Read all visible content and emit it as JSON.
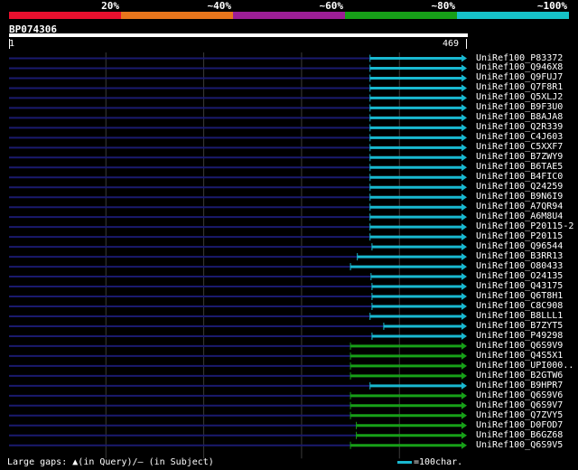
{
  "legend": {
    "segments": [
      {
        "label": "20%",
        "color": "#e8102e"
      },
      {
        "label": "~40%",
        "color": "#e8761c"
      },
      {
        "label": "~60%",
        "color": "#9c1e96"
      },
      {
        "label": "~80%",
        "color": "#17a018"
      },
      {
        "label": "~100%",
        "color": "#16c2c8"
      }
    ]
  },
  "query": {
    "name": "BP074306",
    "start": "1",
    "end": "469"
  },
  "colors": {
    "cyan": "#19b8d0",
    "green": "#17a018",
    "navy": "#1a1a6e",
    "grid": "#3a3a3a"
  },
  "hits": [
    {
      "name": "UniRef100_P83372",
      "start": 370,
      "end": 469,
      "color": "cyan"
    },
    {
      "name": "UniRef100_Q946X8",
      "start": 370,
      "end": 469,
      "color": "cyan"
    },
    {
      "name": "UniRef100_Q9FUJ7",
      "start": 370,
      "end": 469,
      "color": "cyan"
    },
    {
      "name": "UniRef100_Q7F8R1",
      "start": 370,
      "end": 469,
      "color": "cyan"
    },
    {
      "name": "UniRef100_Q5XLJ2",
      "start": 370,
      "end": 469,
      "color": "cyan"
    },
    {
      "name": "UniRef100_B9F3U0",
      "start": 370,
      "end": 469,
      "color": "cyan"
    },
    {
      "name": "UniRef100_B8AJA8",
      "start": 370,
      "end": 469,
      "color": "cyan"
    },
    {
      "name": "UniRef100_Q2R339",
      "start": 370,
      "end": 469,
      "color": "cyan"
    },
    {
      "name": "UniRef100_C4J603",
      "start": 370,
      "end": 469,
      "color": "cyan"
    },
    {
      "name": "UniRef100_C5XXF7",
      "start": 370,
      "end": 469,
      "color": "cyan"
    },
    {
      "name": "UniRef100_B7ZWY9",
      "start": 370,
      "end": 469,
      "color": "cyan"
    },
    {
      "name": "UniRef100_B6TAE5",
      "start": 370,
      "end": 469,
      "color": "cyan"
    },
    {
      "name": "UniRef100_B4FIC0",
      "start": 370,
      "end": 469,
      "color": "cyan"
    },
    {
      "name": "UniRef100_Q24259",
      "start": 370,
      "end": 469,
      "color": "cyan"
    },
    {
      "name": "UniRef100_B9N6I9",
      "start": 370,
      "end": 469,
      "color": "cyan"
    },
    {
      "name": "UniRef100_A7QR94",
      "start": 370,
      "end": 469,
      "color": "cyan"
    },
    {
      "name": "UniRef100_A6M8U4",
      "start": 370,
      "end": 469,
      "color": "cyan"
    },
    {
      "name": "UniRef100_P20115-2",
      "start": 370,
      "end": 469,
      "color": "cyan"
    },
    {
      "name": "UniRef100_P20115",
      "start": 370,
      "end": 469,
      "color": "cyan"
    },
    {
      "name": "UniRef100_Q96544",
      "start": 372,
      "end": 469,
      "color": "cyan"
    },
    {
      "name": "UniRef100_B3RR13",
      "start": 357,
      "end": 469,
      "color": "cyan"
    },
    {
      "name": "UniRef100_O80433",
      "start": 350,
      "end": 469,
      "color": "cyan"
    },
    {
      "name": "UniRef100_O24135",
      "start": 371,
      "end": 469,
      "color": "cyan"
    },
    {
      "name": "UniRef100_Q43175",
      "start": 372,
      "end": 469,
      "color": "cyan"
    },
    {
      "name": "UniRef100_Q6T8H1",
      "start": 372,
      "end": 469,
      "color": "cyan"
    },
    {
      "name": "UniRef100_C8C908",
      "start": 372,
      "end": 469,
      "color": "cyan"
    },
    {
      "name": "UniRef100_B8LLL1",
      "start": 370,
      "end": 469,
      "color": "cyan"
    },
    {
      "name": "UniRef100_B7ZYT5",
      "start": 384,
      "end": 469,
      "color": "cyan"
    },
    {
      "name": "UniRef100_P49298",
      "start": 372,
      "end": 469,
      "color": "cyan"
    },
    {
      "name": "UniRef100_Q6S9V9",
      "start": 350,
      "end": 469,
      "color": "green"
    },
    {
      "name": "UniRef100_Q4S5X1",
      "start": 350,
      "end": 469,
      "color": "green"
    },
    {
      "name": "UniRef100_UPI000..",
      "start": 350,
      "end": 469,
      "color": "green"
    },
    {
      "name": "UniRef100_B2GTW6",
      "start": 350,
      "end": 469,
      "color": "green"
    },
    {
      "name": "UniRef100_B9HPR7",
      "start": 370,
      "end": 469,
      "color": "cyan"
    },
    {
      "name": "UniRef100_Q6S9V6",
      "start": 350,
      "end": 469,
      "color": "green"
    },
    {
      "name": "UniRef100_Q6S9V7",
      "start": 350,
      "end": 469,
      "color": "green"
    },
    {
      "name": "UniRef100_Q7ZVY5",
      "start": 350,
      "end": 469,
      "color": "green"
    },
    {
      "name": "UniRef100_D0FOD7",
      "start": 356,
      "end": 469,
      "color": "green"
    },
    {
      "name": "UniRef100_B6GZ68",
      "start": 356,
      "end": 469,
      "color": "green"
    },
    {
      "name": "UniRef100_Q6S9V5",
      "start": 350,
      "end": 469,
      "color": "green"
    }
  ],
  "footer": {
    "gaps_label": "Large gaps:",
    "query_gap_glyph": "▲",
    "query_gap_text": "(in Query)",
    "subject_gap_text": "/— (in Subject)",
    "scale_text": "=100char."
  }
}
